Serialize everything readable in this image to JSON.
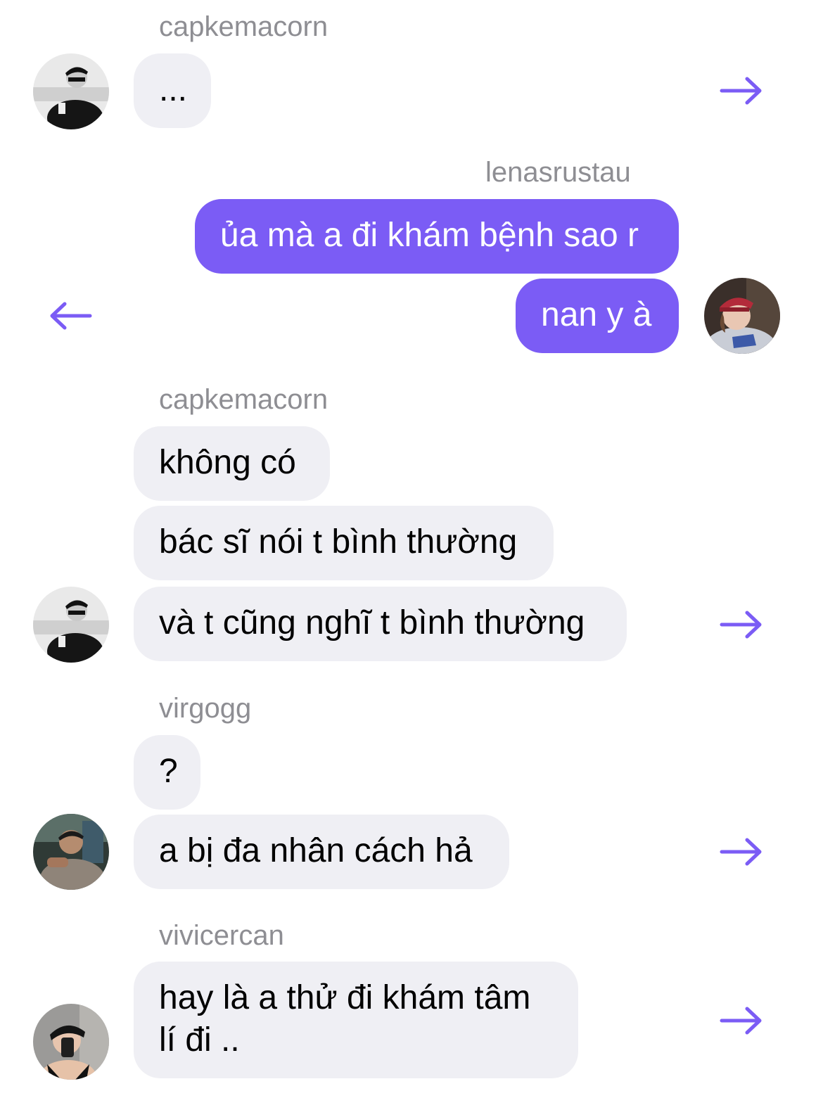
{
  "messages": [
    {
      "sender": "capkemacorn",
      "bubbles": [
        "..."
      ]
    },
    {
      "sender": "lenasrustau",
      "bubbles": [
        "ủa mà a đi khám bệnh sao r",
        "nan y à"
      ]
    },
    {
      "sender": "capkemacorn",
      "bubbles": [
        "không có",
        "bác sĩ nói t bình thường",
        "và t cũng nghĩ t bình thường"
      ]
    },
    {
      "sender": "virgogg",
      "bubbles": [
        "?",
        "a bị đa nhân cách hả"
      ]
    },
    {
      "sender": "vivicercan",
      "bubbles": [
        "hay là a thử đi khám tâm lí đi .."
      ]
    }
  ],
  "colors": {
    "accent": "#7b5cf5",
    "incoming_bubble": "#efeff4",
    "sender_label": "#8e8e93"
  },
  "icons": {
    "share_incoming": "arrow-right-icon",
    "share_outgoing": "arrow-left-icon"
  }
}
